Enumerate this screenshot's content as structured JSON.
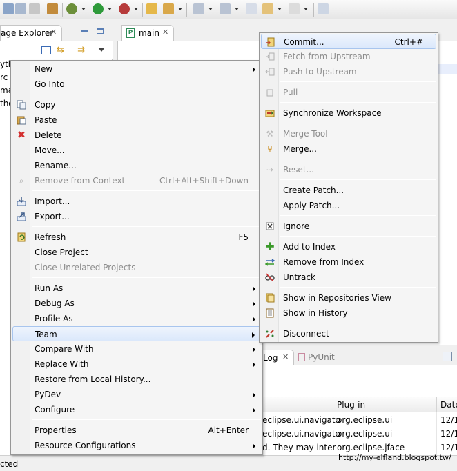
{
  "package_explorer": {
    "tab_label": "age Explorer",
    "tree_rows": [
      "yth",
      "rc",
      "ma",
      "tho"
    ]
  },
  "editor": {
    "tab_label": "main",
    "tab_icon": "P"
  },
  "context_menu": {
    "items": [
      {
        "label": "New",
        "submenu": true
      },
      {
        "label": "Go Into"
      },
      {
        "label": "Copy",
        "icon": "copy-icon"
      },
      {
        "label": "Paste",
        "icon": "paste-icon"
      },
      {
        "label": "Delete",
        "icon": "delete-icon"
      },
      {
        "label": "Move..."
      },
      {
        "label": "Rename..."
      },
      {
        "label": "Remove from Context",
        "accel": "Ctrl+Alt+Shift+Down",
        "disabled": true,
        "icon": "remove-context-icon"
      },
      {
        "label": "Import...",
        "icon": "import-icon"
      },
      {
        "label": "Export...",
        "icon": "export-icon"
      },
      {
        "label": "Refresh",
        "accel": "F5",
        "icon": "refresh-icon"
      },
      {
        "label": "Close Project"
      },
      {
        "label": "Close Unrelated Projects",
        "disabled": true
      },
      {
        "label": "Run As",
        "submenu": true
      },
      {
        "label": "Debug As",
        "submenu": true
      },
      {
        "label": "Profile As",
        "submenu": true
      },
      {
        "label": "Team",
        "submenu": true,
        "highlighted": true
      },
      {
        "label": "Compare With",
        "submenu": true
      },
      {
        "label": "Replace With",
        "submenu": true
      },
      {
        "label": "Restore from Local History..."
      },
      {
        "label": "PyDev",
        "submenu": true
      },
      {
        "label": "Configure",
        "submenu": true
      },
      {
        "label": "Properties",
        "accel": "Alt+Enter"
      },
      {
        "label": "Resource Configurations",
        "submenu": true
      }
    ]
  },
  "team_menu": {
    "items": [
      {
        "label": "Commit...",
        "accel": "Ctrl+#",
        "highlighted": true,
        "icon": "commit-icon"
      },
      {
        "label": "Fetch from Upstream",
        "disabled": true,
        "icon": "fetch-icon"
      },
      {
        "label": "Push to Upstream",
        "disabled": true,
        "icon": "push-icon"
      },
      {
        "label": "Pull",
        "disabled": true,
        "icon": "pull-icon"
      },
      {
        "label": "Synchronize Workspace",
        "icon": "synchronize-icon"
      },
      {
        "label": "Merge Tool",
        "disabled": true,
        "icon": "merge-tool-icon"
      },
      {
        "label": "Merge...",
        "icon": "merge-icon"
      },
      {
        "label": "Reset...",
        "disabled": true,
        "icon": "reset-icon"
      },
      {
        "label": "Create Patch..."
      },
      {
        "label": "Apply Patch..."
      },
      {
        "label": "Ignore",
        "icon": "ignore-icon"
      },
      {
        "label": "Add to Index",
        "icon": "add-to-index-icon"
      },
      {
        "label": "Remove from Index",
        "icon": "remove-from-index-icon"
      },
      {
        "label": "Untrack",
        "icon": "untrack-icon"
      },
      {
        "label": "Show in Repositories View",
        "icon": "repositories-view-icon"
      },
      {
        "label": "Show in History",
        "icon": "history-icon"
      },
      {
        "label": "Disconnect",
        "icon": "disconnect-icon"
      }
    ]
  },
  "bottom_view": {
    "tabs": [
      {
        "label": "Log"
      },
      {
        "label": "PyUnit"
      }
    ],
    "columns": [
      "Plug-in",
      "Date"
    ],
    "rows": [
      {
        "message": "eclipse.ui.navigato",
        "plugin": "org.eclipse.ui",
        "date": "12/1"
      },
      {
        "message": "eclipse.ui.navigato",
        "plugin": "org.eclipse.ui",
        "date": "12/1"
      },
      {
        "message": "d. They may inter",
        "plugin": "org.eclipse.jface",
        "date": "12/1"
      }
    ]
  },
  "status_bar": {
    "text": "cted"
  },
  "watermark": "http://my-elfland.blogspot.tw/",
  "colors": {
    "menu_highlight": "#dbe8fb",
    "disabled_text": "#8d8d8d",
    "delete_red": "#d32f2f"
  }
}
